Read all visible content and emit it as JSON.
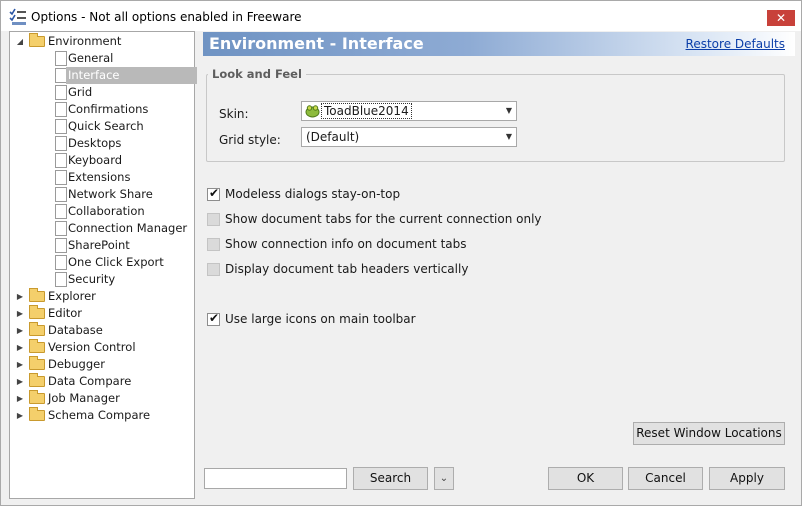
{
  "window": {
    "title": "Options - Not all options enabled in Freeware",
    "close_glyph": "✕"
  },
  "tree": {
    "environment": {
      "label": "Environment",
      "children": [
        "General",
        "Interface",
        "Grid",
        "Confirmations",
        "Quick Search",
        "Desktops",
        "Keyboard",
        "Extensions",
        "Network Share",
        "Collaboration",
        "Connection Manager",
        "SharePoint",
        "One Click Export",
        "Security"
      ],
      "selected": "Interface"
    },
    "roots": [
      "Explorer",
      "Editor",
      "Database",
      "Version Control",
      "Debugger",
      "Data Compare",
      "Job Manager",
      "Schema Compare"
    ]
  },
  "header": {
    "title": "Environment - Interface",
    "restore_link": "Restore Defaults"
  },
  "look_and_feel": {
    "legend": "Look and Feel",
    "skin_label": "Skin:",
    "skin_value": "ToadBlue2014",
    "grid_style_label": "Grid style:",
    "grid_style_value": "(Default)"
  },
  "options": {
    "modeless": {
      "label": "Modeless dialogs stay-on-top",
      "checked": true
    },
    "doc_tabs": {
      "label": "Show document tabs for the current connection only",
      "checked": false
    },
    "conn_info": {
      "label": "Show connection info on document tabs",
      "checked": false
    },
    "vertical": {
      "label": "Display document tab headers vertically",
      "checked": false
    },
    "large_icons": {
      "label": "Use large icons on main toolbar",
      "checked": true
    }
  },
  "buttons": {
    "reset": "Reset Window Locations",
    "search": "Search",
    "ok": "OK",
    "cancel": "Cancel",
    "apply": "Apply"
  },
  "search": {
    "value": ""
  }
}
